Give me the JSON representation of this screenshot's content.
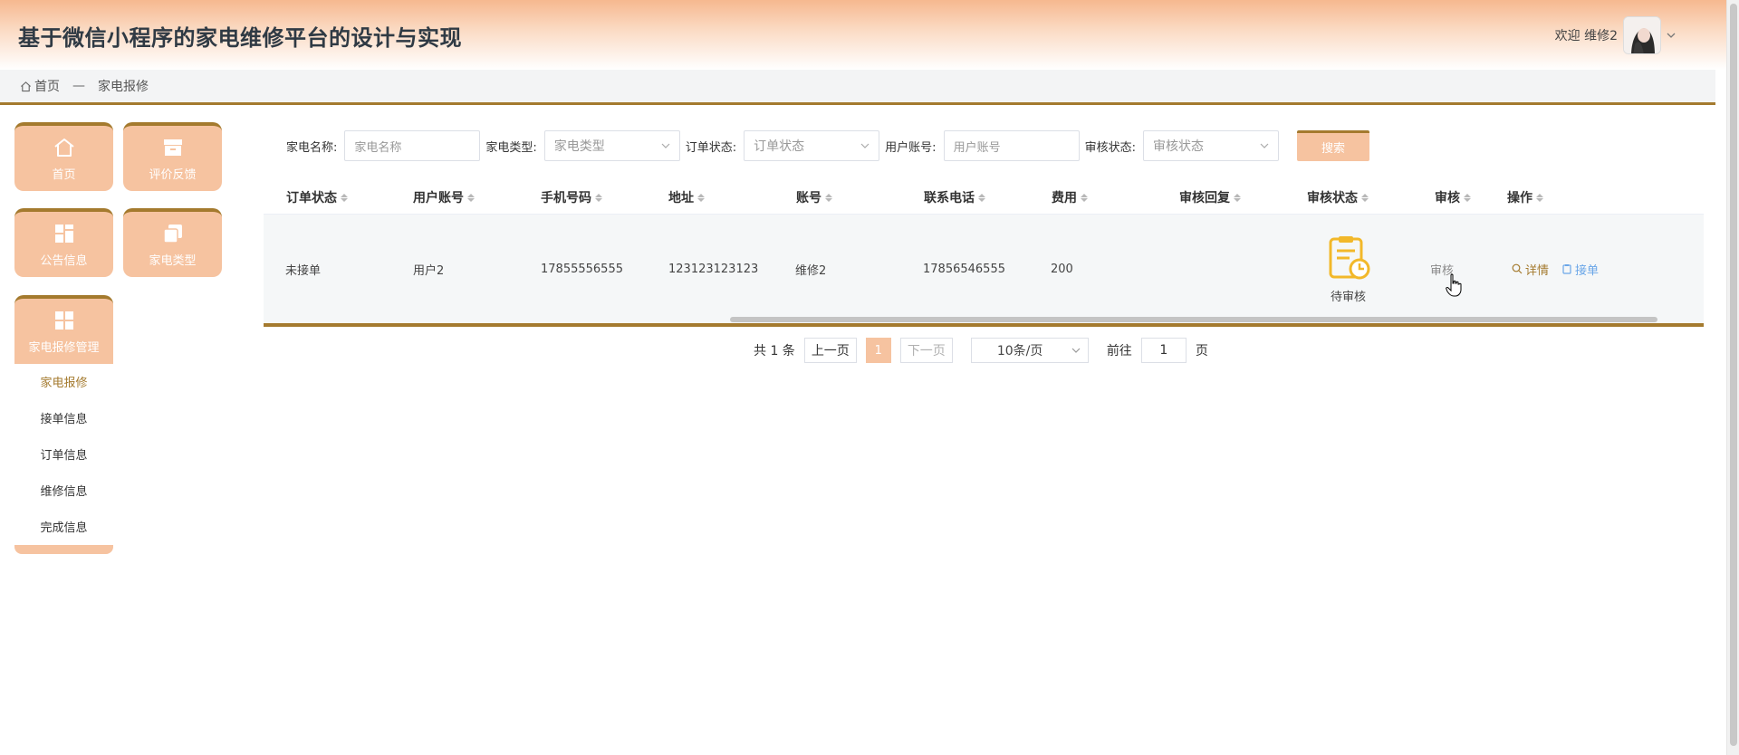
{
  "header": {
    "title": "基于微信小程序的家电维修平台的设计与实现",
    "welcome": "欢迎 维修2"
  },
  "breadcrumb": {
    "home": "首页",
    "separator": "—",
    "current": "家电报修"
  },
  "sidebar": {
    "tiles": [
      {
        "label": "首页",
        "icon": "home-icon"
      },
      {
        "label": "评价反馈",
        "icon": "archive-icon"
      },
      {
        "label": "公告信息",
        "icon": "grid-icon"
      },
      {
        "label": "家电类型",
        "icon": "copy-icon"
      },
      {
        "label": "家电报修管理",
        "icon": "apps-icon"
      }
    ],
    "submenu": [
      "家电报修",
      "接单信息",
      "订单信息",
      "维修信息",
      "完成信息"
    ]
  },
  "search": {
    "name_label": "家电名称:",
    "name_placeholder": "家电名称",
    "type_label": "家电类型:",
    "type_placeholder": "家电类型",
    "order_status_label": "订单状态:",
    "order_status_placeholder": "订单状态",
    "account_label": "用户账号:",
    "account_placeholder": "用户账号",
    "review_status_label": "审核状态:",
    "review_status_placeholder": "审核状态",
    "button": "搜索"
  },
  "table": {
    "headers": [
      "订单状态",
      "用户账号",
      "手机号码",
      "地址",
      "账号",
      "联系电话",
      "费用",
      "审核回复",
      "审核状态",
      "审核",
      "操作"
    ],
    "rows": [
      {
        "order_status": "未接单",
        "user_account": "用户2",
        "phone": "17855556555",
        "address": "123123123123",
        "account": "维修2",
        "contact": "17856546555",
        "fee": "200",
        "review_reply": "",
        "review_status": "待审核",
        "review_action": "审核",
        "detail": "详情",
        "take": "接单"
      }
    ]
  },
  "pagination": {
    "total": "共 1 条",
    "prev": "上一页",
    "current": "1",
    "next": "下一页",
    "page_size": "10条/页",
    "goto_label": "前往",
    "goto_value": "1",
    "page_suffix": "页"
  },
  "colors": {
    "accent": "#f6c3a0",
    "accent_dark": "#a47a2e",
    "status_icon": "#f2b82a"
  }
}
